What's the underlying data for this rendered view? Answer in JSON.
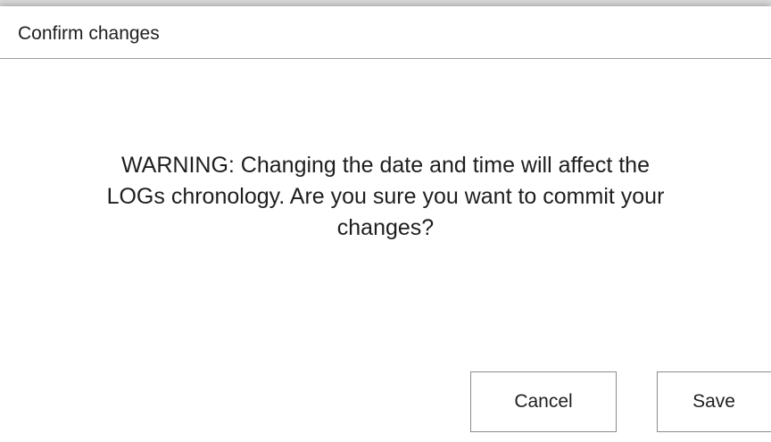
{
  "dialog": {
    "title": "Confirm changes",
    "message_lines": [
      "WARNING: Changing the date and time will affect the",
      "LOGs chronology. Are you sure you want to commit your",
      "changes?"
    ],
    "buttons": {
      "cancel_label": "Cancel",
      "save_label": "Save"
    }
  }
}
